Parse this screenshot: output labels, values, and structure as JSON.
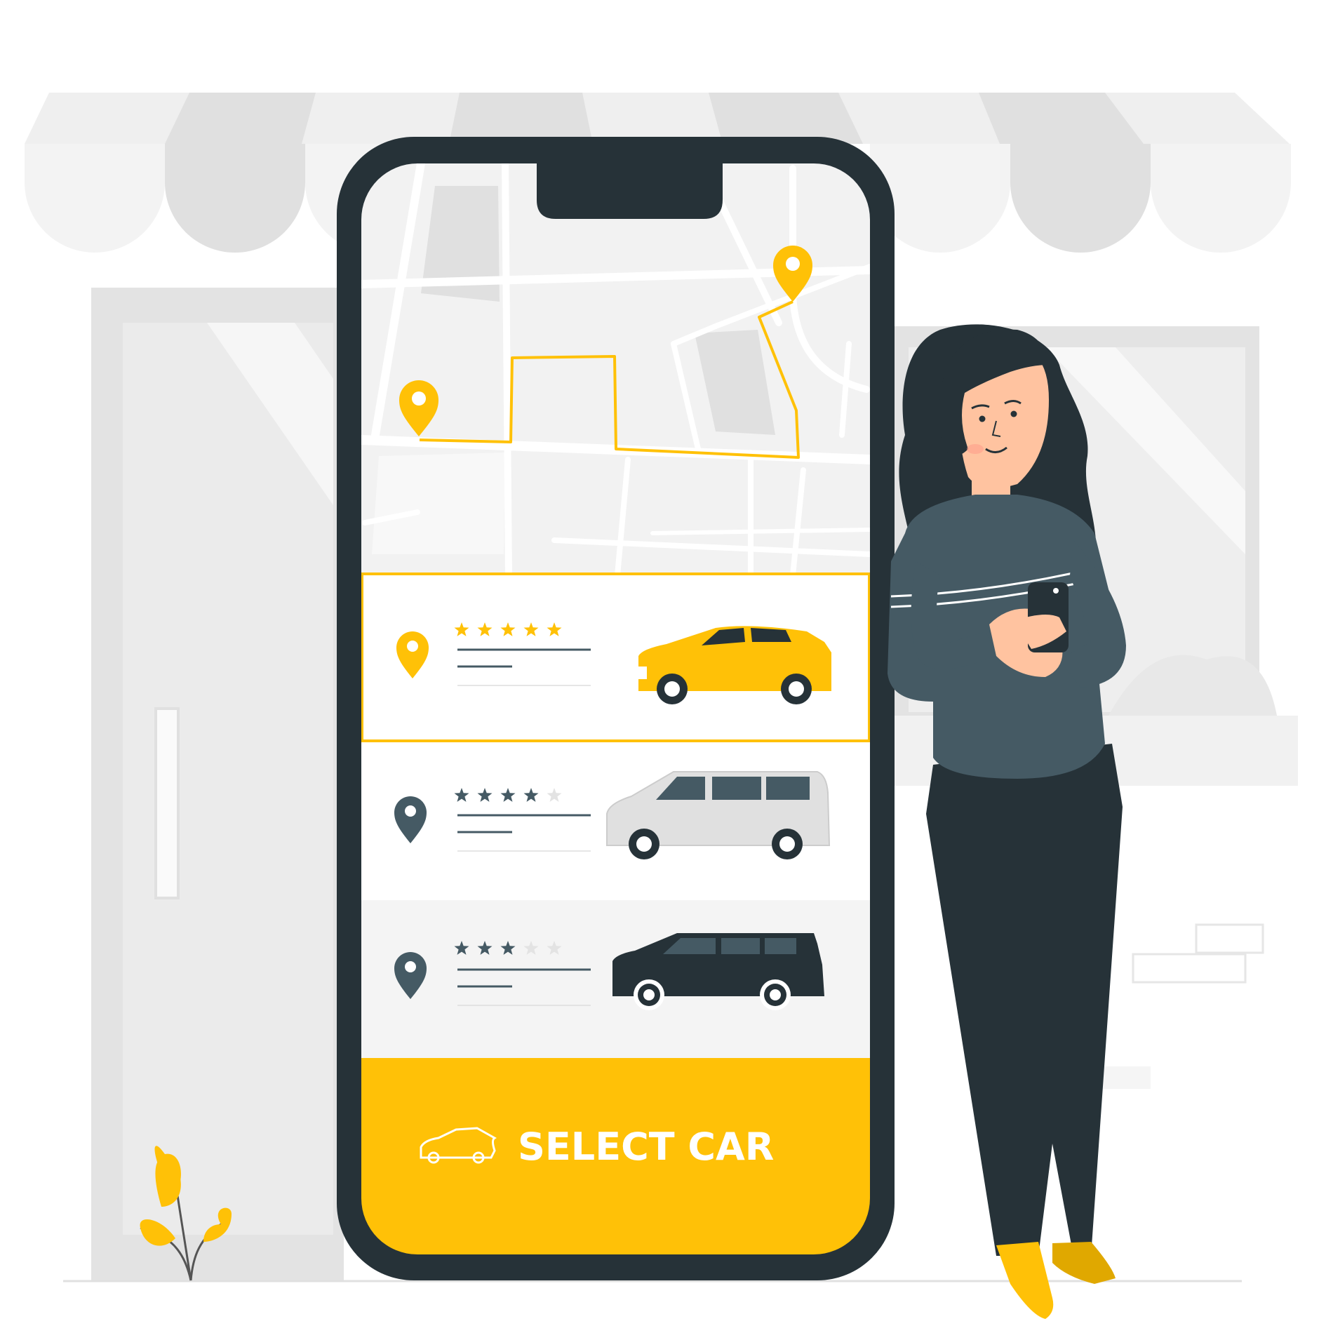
{
  "colors": {
    "accent": "#FFC107",
    "dark": "#263238",
    "sweater": "#455A64",
    "skin": "#FFC3A0",
    "map_bg": "#F2F2F2",
    "map_block": "#E0E0E0",
    "store_grey": "#E3E3E3"
  },
  "screen": {
    "map": {
      "pins": [
        "map-pin-icon",
        "map-pin-icon"
      ]
    },
    "car_options": [
      {
        "rating": 5,
        "max_rating": 5,
        "car": "yellow-hatchback-icon",
        "selected": true
      },
      {
        "rating": 4,
        "max_rating": 5,
        "car": "white-van-icon",
        "selected": false
      },
      {
        "rating": 3,
        "max_rating": 5,
        "car": "black-suv-icon",
        "selected": false
      }
    ],
    "cta": {
      "label": "SELECT CAR",
      "icon": "car-outline-icon"
    }
  }
}
